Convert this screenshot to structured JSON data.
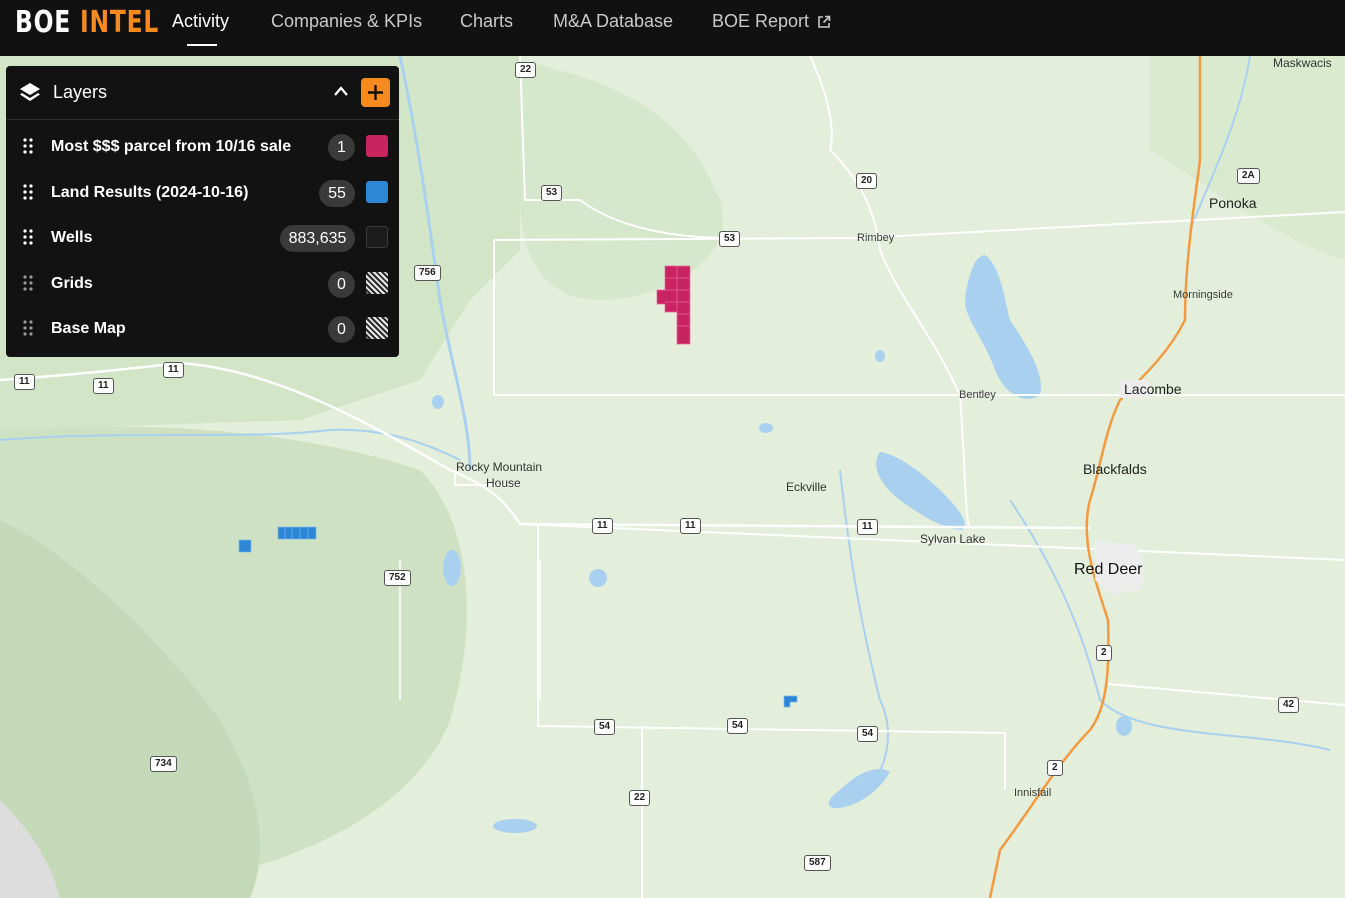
{
  "header": {
    "logo_part1": "BOE",
    "logo_part2": "INTEL",
    "nav": [
      {
        "label": "Activity",
        "active": true
      },
      {
        "label": "Companies & KPIs"
      },
      {
        "label": "Charts"
      },
      {
        "label": "M&A Database"
      },
      {
        "label": "BOE Report",
        "icon": "external-link-icon"
      }
    ]
  },
  "layers_panel": {
    "title": "Layers",
    "icons": {
      "header": "layers-icon",
      "collapse": "chevron-up-icon",
      "add": "plus-icon",
      "drag": "drag-handle-icon"
    },
    "items": [
      {
        "label": "Most $$$ parcel from 10/16 sale",
        "count": "1",
        "color": "#c8245f"
      },
      {
        "label": "Land Results (2024-10-16)",
        "count": "55",
        "color": "#2e86d6"
      },
      {
        "label": "Wells",
        "count": "883,635",
        "color": "#1c1c1c"
      },
      {
        "label": "Grids",
        "count": "0",
        "color": "hatched"
      },
      {
        "label": "Base Map",
        "count": "0",
        "color": "hatched"
      }
    ]
  },
  "map": {
    "places": [
      "Maskwacis",
      "Ponoka",
      "Rimbey",
      "Morningside",
      "Bentley",
      "Lacombe",
      "Blackfalds",
      "Rocky Mountain",
      "House",
      "Eckville",
      "Sylvan Lake",
      "Red Deer",
      "Innisfail"
    ],
    "road_shields": [
      "22",
      "53",
      "20",
      "2A",
      "53",
      "756",
      "11",
      "11",
      "11",
      "11",
      "11",
      "11",
      "752",
      "2",
      "42",
      "54",
      "54",
      "54",
      "2",
      "734",
      "22",
      "587"
    ],
    "colors": {
      "land": "#e3eedb",
      "forest": "#cfe4c5",
      "water": "#a9d1ef",
      "road": "#ffffff",
      "highway": "#f39a41"
    }
  }
}
